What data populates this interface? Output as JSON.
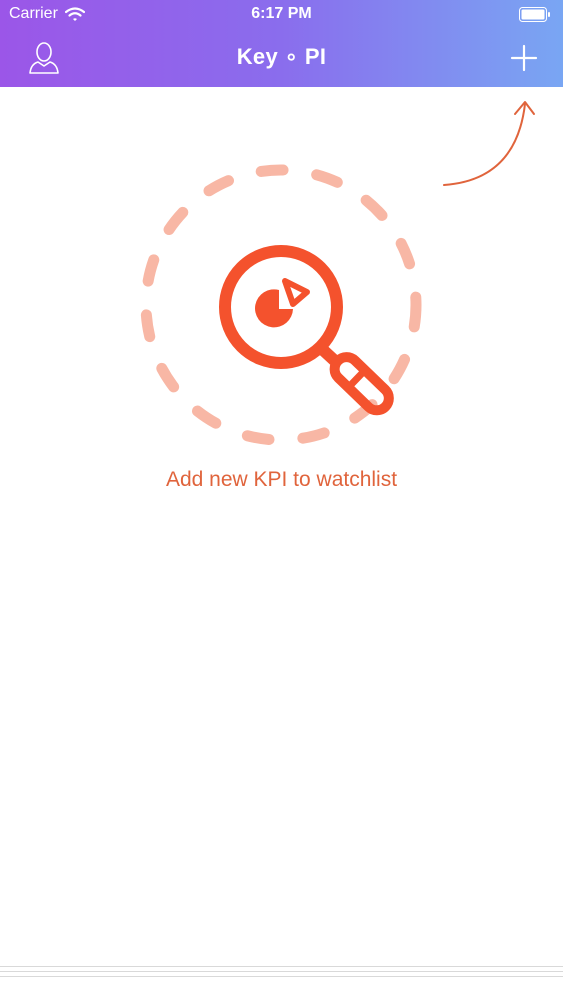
{
  "status_bar": {
    "carrier": "Carrier",
    "time": "6:17 PM"
  },
  "nav": {
    "title": "Key ∘ PI",
    "left_icon": "user-profile-icon",
    "right_icon": "plus-icon"
  },
  "empty_state": {
    "message": "Add new KPI to watchlist",
    "icon": "magnifier-pie-chart-icon",
    "hint": "curved-arrow-icon"
  },
  "colors": {
    "header_gradient_start": "#9b56e8",
    "header_gradient_end": "#79a6f3",
    "accent": "#f4522d",
    "accent_light": "#f8b7a5",
    "message": "#e0643c"
  }
}
